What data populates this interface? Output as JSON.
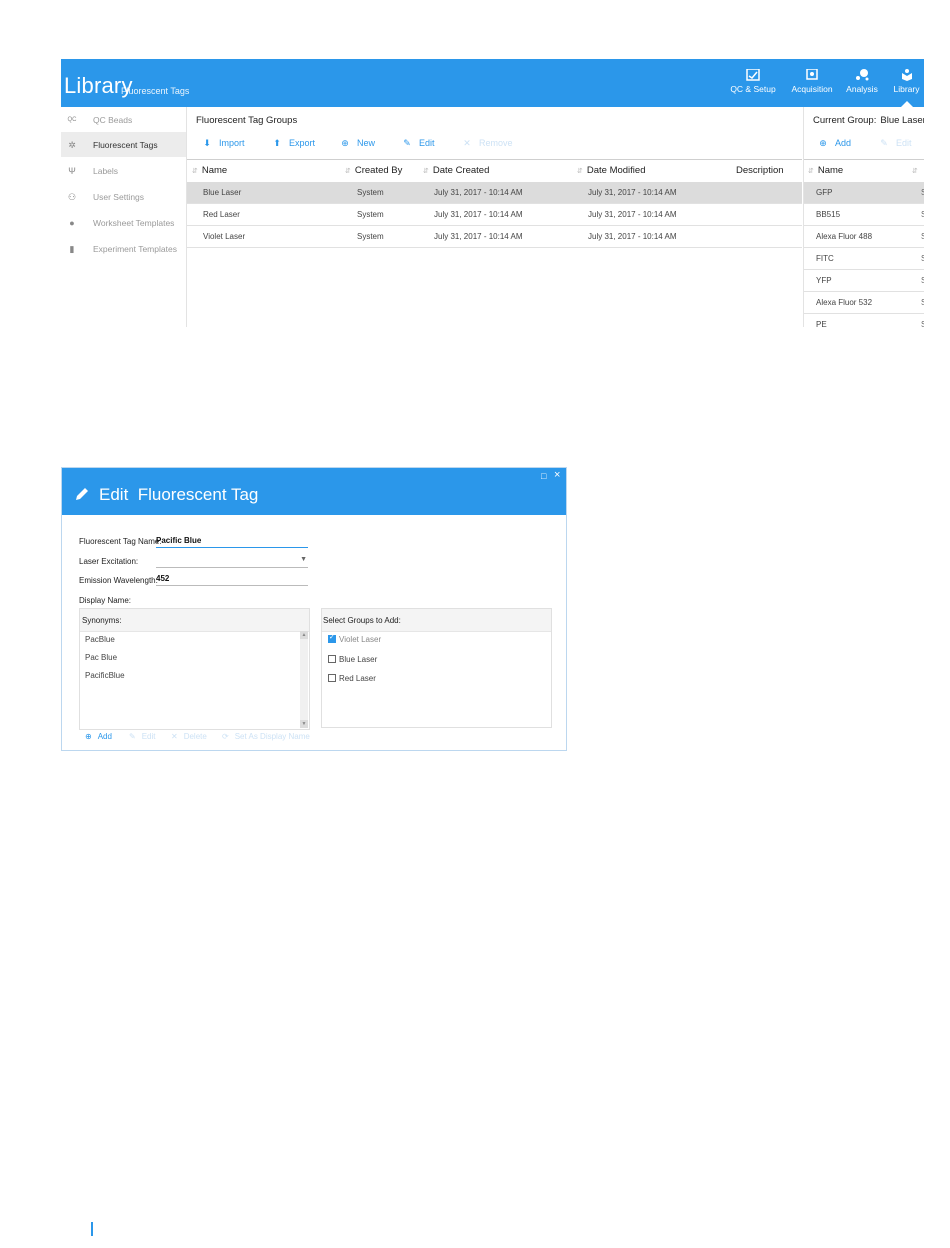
{
  "library": {
    "title": "Library",
    "subtitle": "Fluorescent Tags",
    "nav": [
      {
        "label": "QC & Setup",
        "icon": "qc-setup-icon"
      },
      {
        "label": "Acquisition",
        "icon": "acquisition-icon"
      },
      {
        "label": "Analysis",
        "icon": "analysis-icon"
      },
      {
        "label": "Library",
        "icon": "library-icon",
        "active": true
      }
    ],
    "sidebar": [
      {
        "label": "QC Beads",
        "icon": "qc-beads-icon"
      },
      {
        "label": "Fluorescent Tags",
        "icon": "fluorescent-tags-icon",
        "selected": true
      },
      {
        "label": "Labels",
        "icon": "labels-icon"
      },
      {
        "label": "User Settings",
        "icon": "user-settings-icon"
      },
      {
        "label": "Worksheet Templates",
        "icon": "worksheet-templates-icon"
      },
      {
        "label": "Experiment Templates",
        "icon": "experiment-templates-icon"
      }
    ],
    "groups_panel": {
      "title": "Fluorescent Tag Groups",
      "toolbar": {
        "import": "Import",
        "export": "Export",
        "new": "New",
        "edit": "Edit",
        "remove": "Remove"
      },
      "columns": [
        "Name",
        "Created By",
        "Date Created",
        "Date Modified",
        "Description"
      ],
      "rows": [
        {
          "name": "Blue Laser",
          "created_by": "System",
          "date_created": "July 31, 2017 - 10:14 AM",
          "date_modified": "July 31, 2017 - 10:14 AM",
          "description": "",
          "selected": true
        },
        {
          "name": "Red Laser",
          "created_by": "System",
          "date_created": "July 31, 2017 - 10:14 AM",
          "date_modified": "July 31, 2017 - 10:14 AM",
          "description": ""
        },
        {
          "name": "Violet Laser",
          "created_by": "System",
          "date_created": "July 31, 2017 - 10:14 AM",
          "date_modified": "July 31, 2017 - 10:14 AM",
          "description": ""
        }
      ]
    },
    "current_group_panel": {
      "label": "Current Group:",
      "value": "Blue Laser",
      "toolbar": {
        "add": "Add",
        "edit": "Edit"
      },
      "column": "Name",
      "rows": [
        "GFP",
        "BB515",
        "Alexa Fluor 488",
        "FITC",
        "YFP",
        "Alexa Fluor 532",
        "PE"
      ],
      "clipped_marker": "S"
    }
  },
  "dialog": {
    "title": "Edit  Fluorescent Tag",
    "max_glyph": "□",
    "close_glyph": "×",
    "fields": {
      "name_label": "Fluorescent Tag Name:",
      "name_value": "Pacific Blue",
      "laser_label": "Laser Excitation:",
      "laser_value": "",
      "emission_label": "Emission Wavelength:",
      "emission_value": "452",
      "display_label": "Display Name:"
    },
    "synonyms": {
      "label": "Synonyms:",
      "items": [
        "PacBlue",
        "Pac Blue",
        "PacificBlue"
      ]
    },
    "groups": {
      "label": "Select Groups to Add:",
      "items": [
        {
          "label": "Violet Laser",
          "checked": true
        },
        {
          "label": "Blue Laser",
          "checked": false
        },
        {
          "label": "Red Laser",
          "checked": false
        }
      ]
    },
    "buttons": {
      "add": "Add",
      "edit": "Edit",
      "delete": "Delete",
      "set_display": "Set As Display Name"
    }
  }
}
